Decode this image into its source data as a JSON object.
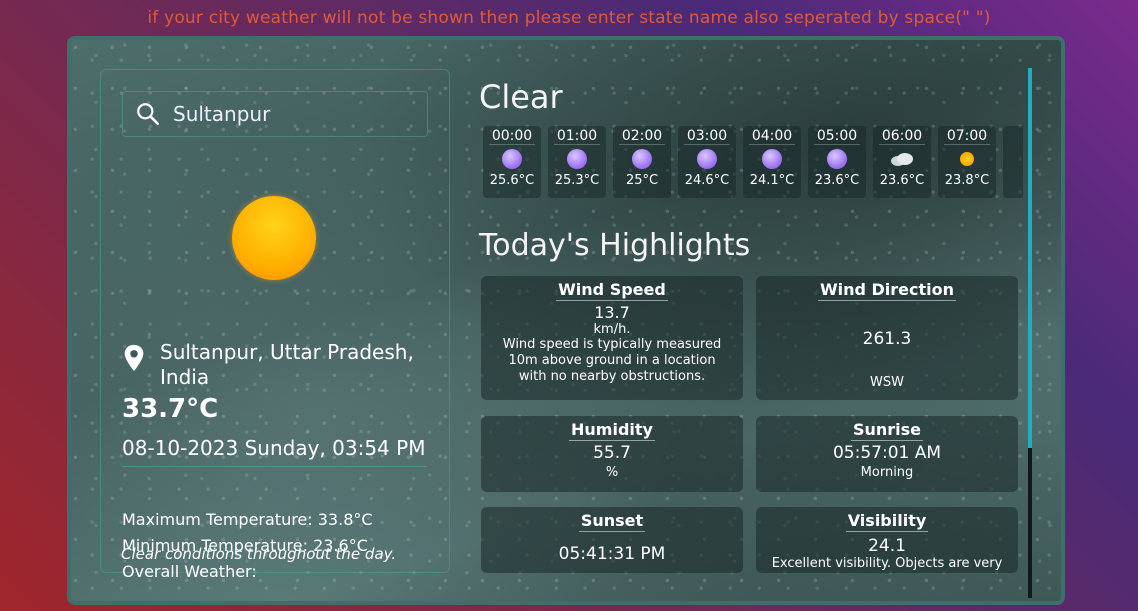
{
  "notice": "if your city weather will not be shown then please enter state name also seperated by space(\" \")",
  "search": {
    "value": "Sultanpur"
  },
  "left": {
    "location": "Sultanpur, Uttar Pradesh, India",
    "temperature": "33.7°C",
    "datetime": "08-10-2023 Sunday, 03:54 PM",
    "max_temp": "Maximum Temperature: 33.8°C",
    "min_temp": "Minimum Temperature: 23.6°C",
    "overall_label": "Overall Weather:",
    "overall_desc": "Clear conditions throughout the day."
  },
  "condition": "Clear",
  "hourly": [
    {
      "time": "00:00",
      "temp": "25.6°C",
      "icon": "moon-icon"
    },
    {
      "time": "01:00",
      "temp": "25.3°C",
      "icon": "moon-icon"
    },
    {
      "time": "02:00",
      "temp": "25°C",
      "icon": "moon-icon"
    },
    {
      "time": "03:00",
      "temp": "24.6°C",
      "icon": "moon-icon"
    },
    {
      "time": "04:00",
      "temp": "24.1°C",
      "icon": "moon-icon"
    },
    {
      "time": "05:00",
      "temp": "23.6°C",
      "icon": "moon-icon"
    },
    {
      "time": "06:00",
      "temp": "23.6°C",
      "icon": "cloud-icon"
    },
    {
      "time": "07:00",
      "temp": "23.8°C",
      "icon": "sun-icon"
    }
  ],
  "highlights_title": "Today's Highlights",
  "highlights": {
    "wind_speed": {
      "title": "Wind Speed",
      "value": "13.7",
      "unit": "km/h.",
      "note": "Wind speed is typically measured 10m above ground in a location with no nearby obstructions."
    },
    "wind_direction": {
      "title": "Wind Direction",
      "value": "261.3",
      "unit": "WSW"
    },
    "humidity": {
      "title": "Humidity",
      "value": "55.7",
      "unit": "%"
    },
    "sunrise": {
      "title": "Sunrise",
      "value": "05:57:01 AM",
      "unit": "Morning"
    },
    "sunset": {
      "title": "Sunset",
      "value": "05:41:31 PM"
    },
    "visibility": {
      "title": "Visibility",
      "value": "24.1",
      "note": "Excellent visibility. Objects are very"
    }
  },
  "colors": {
    "accent": "#1fb0c0",
    "notice": "#e05a3a",
    "border": "#3f6f6a"
  }
}
